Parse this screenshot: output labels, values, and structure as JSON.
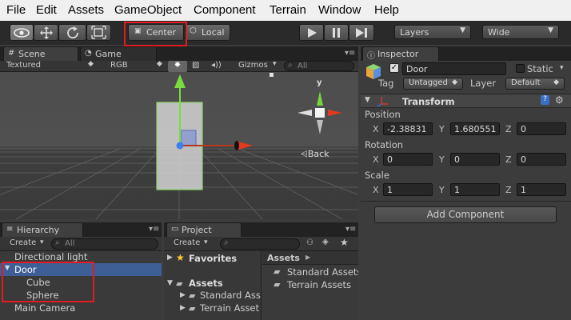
{
  "menu": [
    "File",
    "Edit",
    "Assets",
    "GameObject",
    "Component",
    "Terrain",
    "Window",
    "Help"
  ],
  "toolbar": {
    "pivot_label": "Center",
    "space_label": "Local",
    "layers_label": "Layers",
    "layout_label": "Wide"
  },
  "scene": {
    "tab_scene": "Scene",
    "tab_game": "Game",
    "shading": "Textured",
    "render_mode": "RGB",
    "gizmos": "Gizmos",
    "search_placeholder": "All",
    "axis_y": "y",
    "back_label": "Back"
  },
  "hierarchy": {
    "tab": "Hierarchy",
    "create": "Create",
    "search_placeholder": "All",
    "items": [
      "Directional light",
      "Door",
      "Cube",
      "Sphere",
      "Main Camera"
    ]
  },
  "project": {
    "tab": "Project",
    "create": "Create",
    "favorites": "Favorites",
    "tree_assets": "Assets",
    "tree_children": [
      "Standard Ass",
      "Terrain Asset"
    ],
    "breadcrumb": "Assets",
    "folder_items": [
      "Standard Assets",
      "Terrain Assets"
    ]
  },
  "inspector": {
    "tab": "Inspector",
    "object_name": "Door",
    "static_label": "Static",
    "tag_label": "Tag",
    "tag_value": "Untagged",
    "layer_label": "Layer",
    "layer_value": "Default",
    "component_title": "Transform",
    "position_label": "Position",
    "rotation_label": "Rotation",
    "scale_label": "Scale",
    "axis_x": "X",
    "axis_y": "Y",
    "axis_z": "Z",
    "position": {
      "x": "-2.38831",
      "y": "1.680551",
      "z": "0"
    },
    "rotation": {
      "x": "0",
      "y": "0",
      "z": "0"
    },
    "scale": {
      "x": "1",
      "y": "1",
      "z": "1"
    },
    "add_component": "Add Component"
  },
  "colors": {
    "highlight": "#e11b22",
    "selection": "#3e5f96",
    "axis_x": "#e43a1b",
    "axis_y": "#5fd13a",
    "axis_z": "#3c7ef0"
  }
}
